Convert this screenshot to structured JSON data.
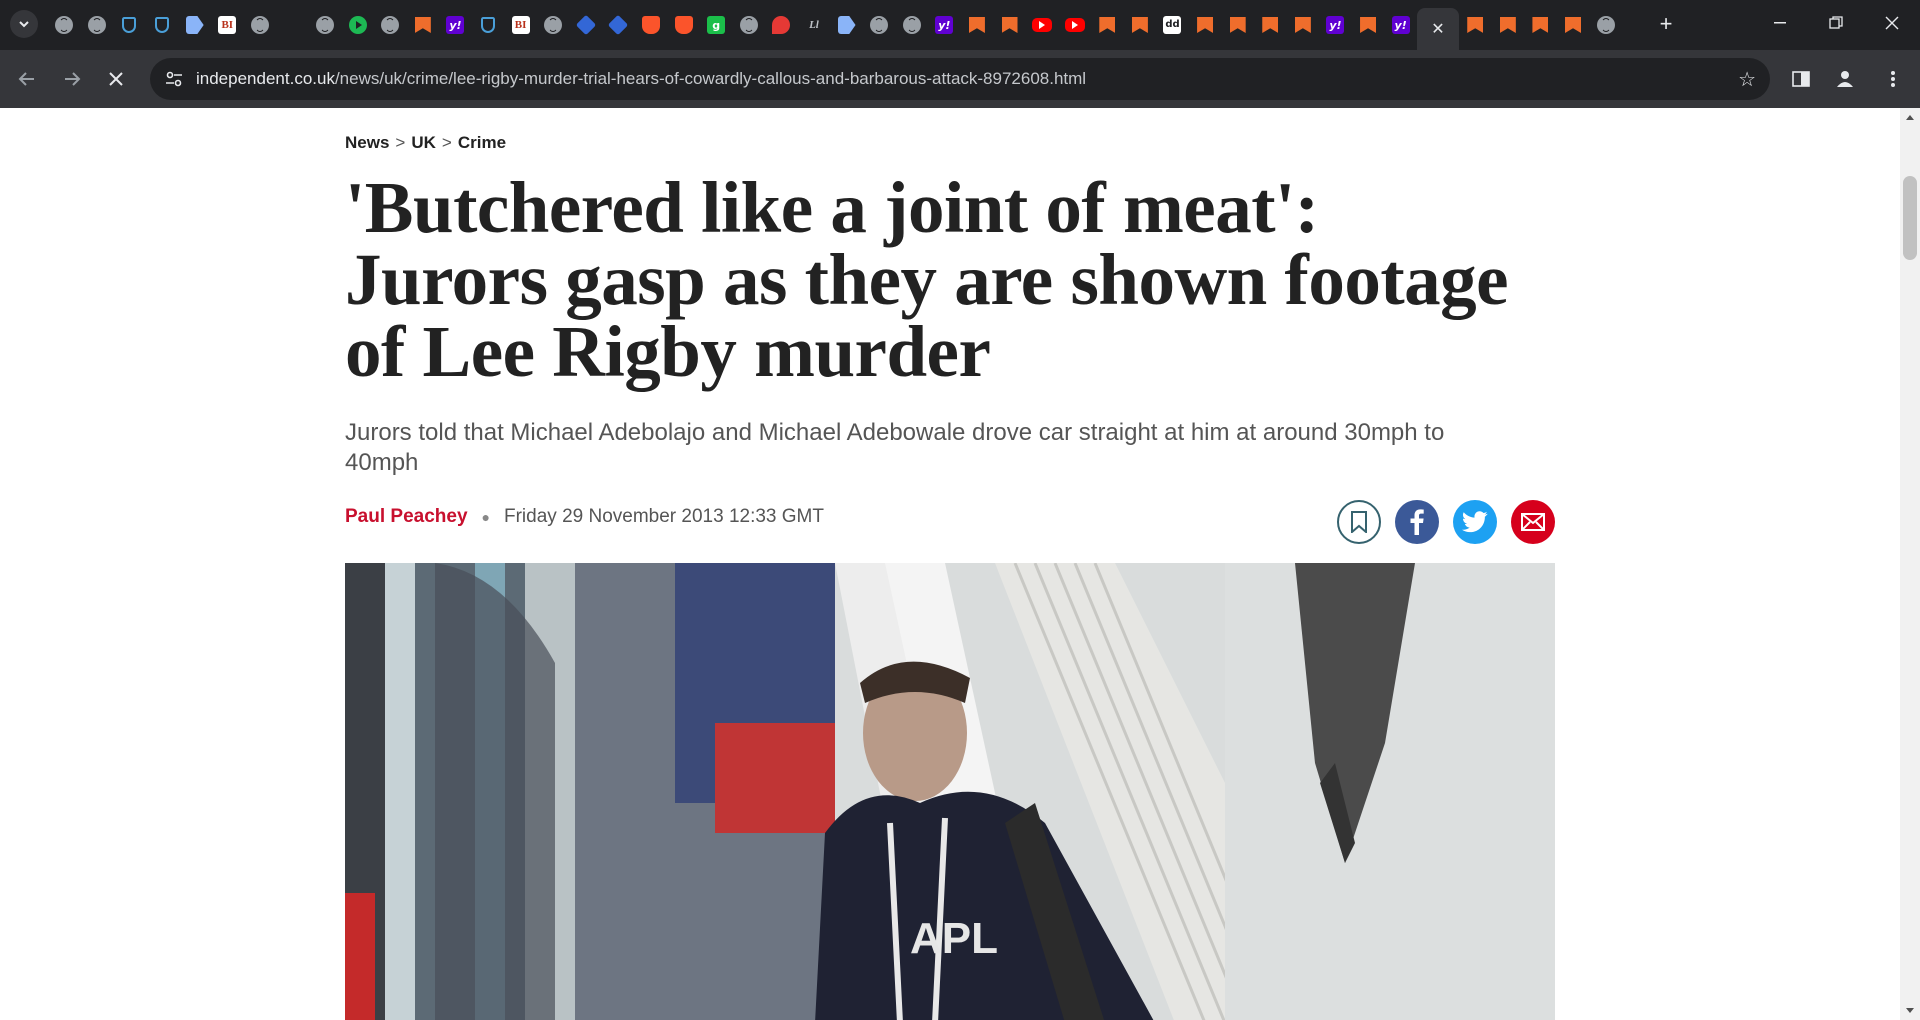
{
  "browser": {
    "url_domain": "independent.co.uk",
    "url_path": "/news/uk/crime/lee-rigby-murder-trial-hears-of-cowardly-callous-and-barbarous-attack-8972608.html",
    "tabs": [
      {
        "icon": "globe-icon"
      },
      {
        "icon": "globe-icon"
      },
      {
        "icon": "shield-icon"
      },
      {
        "icon": "shield-icon"
      },
      {
        "icon": "arrow-icon"
      },
      {
        "icon": "bi-icon",
        "text": "BI"
      },
      {
        "icon": "globe-icon"
      },
      {
        "icon": "search-icon"
      },
      {
        "icon": "globe-icon"
      },
      {
        "icon": "play-icon"
      },
      {
        "icon": "globe-icon"
      },
      {
        "icon": "independent-icon"
      },
      {
        "icon": "yahoo-icon",
        "text": "y!"
      },
      {
        "icon": "shield-icon"
      },
      {
        "icon": "bi-icon",
        "text": "BI"
      },
      {
        "icon": "globe-icon"
      },
      {
        "icon": "cube-icon"
      },
      {
        "icon": "cube-icon"
      },
      {
        "icon": "brave-icon"
      },
      {
        "icon": "brave-icon"
      },
      {
        "icon": "g-icon",
        "text": "g"
      },
      {
        "icon": "globe-icon"
      },
      {
        "icon": "pin-icon"
      },
      {
        "icon": "ll-icon",
        "text": "Ll"
      },
      {
        "icon": "arrow-icon"
      },
      {
        "icon": "globe-icon"
      },
      {
        "icon": "globe-icon"
      },
      {
        "icon": "yahoo-icon",
        "text": "y!"
      },
      {
        "icon": "independent-icon"
      },
      {
        "icon": "independent-icon"
      },
      {
        "icon": "youtube-icon"
      },
      {
        "icon": "youtube-icon"
      },
      {
        "icon": "independent-icon"
      },
      {
        "icon": "independent-icon"
      },
      {
        "icon": "dd-icon",
        "text": "dd"
      },
      {
        "icon": "independent-icon"
      },
      {
        "icon": "independent-icon"
      },
      {
        "icon": "independent-icon"
      },
      {
        "icon": "independent-icon"
      },
      {
        "icon": "yahoo-icon",
        "text": "y!"
      },
      {
        "icon": "independent-icon"
      },
      {
        "icon": "yahoo-icon",
        "text": "y!"
      }
    ],
    "active_tab_close": "✕",
    "tabs_after_active": [
      {
        "icon": "independent-icon"
      },
      {
        "icon": "independent-icon"
      },
      {
        "icon": "independent-icon"
      },
      {
        "icon": "independent-icon"
      },
      {
        "icon": "globe-icon"
      }
    ]
  },
  "article": {
    "breadcrumb": [
      "News",
      "UK",
      "Crime"
    ],
    "breadcrumb_sep": ">",
    "headline": "'Butchered like a joint of meat': Jurors gasp as they are shown footage of Lee Rigby murder",
    "standfirst": "Jurors told that Michael Adebolajo and Michael Adebowale drove car straight at him at around 30mph to 40mph",
    "author": "Paul Peachey",
    "date": "Friday 29 November 2013 12:33 GMT",
    "share": [
      "bookmark-icon",
      "facebook-icon",
      "twitter-icon",
      "email-icon"
    ]
  },
  "colors": {
    "author_red": "#c8102e",
    "facebook": "#3b5998",
    "twitter": "#1da1f2",
    "email": "#d6001c",
    "independent_orange": "#ef6d2c"
  }
}
